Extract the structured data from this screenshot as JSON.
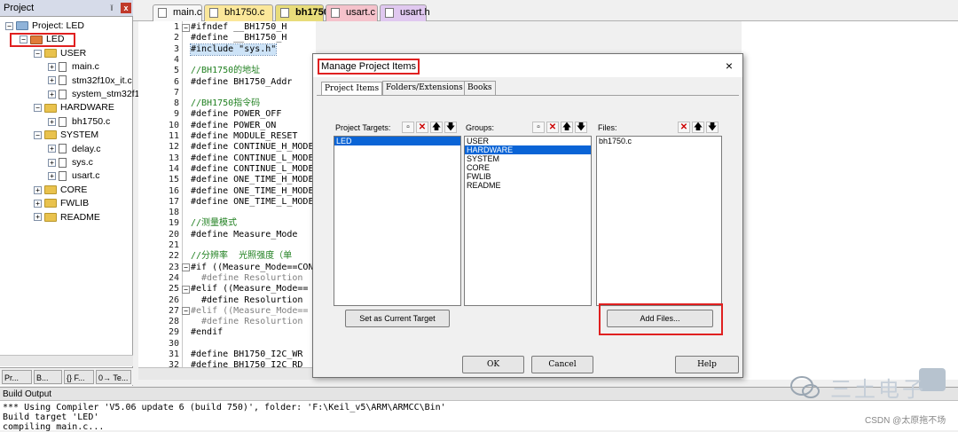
{
  "project_pane": {
    "title": "Project",
    "pin": "ǐ",
    "close": "x",
    "tree": [
      {
        "label": "Project: LED",
        "level": 0,
        "kind": "project",
        "exp": "⊟"
      },
      {
        "label": "LED",
        "level": 1,
        "kind": "target",
        "exp": "⊟"
      },
      {
        "label": "USER",
        "level": 2,
        "kind": "folder",
        "exp": "⊟"
      },
      {
        "label": "main.c",
        "level": 3,
        "kind": "file",
        "exp": "⊞"
      },
      {
        "label": "stm32f10x_it.c",
        "level": 3,
        "kind": "file",
        "exp": "⊞"
      },
      {
        "label": "system_stm32f1",
        "level": 3,
        "kind": "file",
        "exp": "⊞"
      },
      {
        "label": "HARDWARE",
        "level": 2,
        "kind": "folder",
        "exp": "⊟"
      },
      {
        "label": "bh1750.c",
        "level": 3,
        "kind": "file",
        "exp": "⊞"
      },
      {
        "label": "SYSTEM",
        "level": 2,
        "kind": "folder",
        "exp": "⊟"
      },
      {
        "label": "delay.c",
        "level": 3,
        "kind": "file",
        "exp": "⊞"
      },
      {
        "label": "sys.c",
        "level": 3,
        "kind": "file",
        "exp": "⊞"
      },
      {
        "label": "usart.c",
        "level": 3,
        "kind": "file",
        "exp": "⊞"
      },
      {
        "label": "CORE",
        "level": 2,
        "kind": "folder",
        "exp": "⊞"
      },
      {
        "label": "FWLIB",
        "level": 2,
        "kind": "folder",
        "exp": "⊞"
      },
      {
        "label": "README",
        "level": 2,
        "kind": "folder",
        "exp": "⊞"
      }
    ],
    "bottom_tabs": [
      "Pr...",
      "B...",
      "{} F...",
      "0→ Te..."
    ]
  },
  "editor_tabs": [
    {
      "label": "main.c",
      "color": "#f7f7f7"
    },
    {
      "label": "bh1750.c",
      "color": "#fbe79a"
    },
    {
      "label": "bh1750.h",
      "color": "#fbe79a",
      "active": true
    },
    {
      "label": "usart.c",
      "color": "#f5c2cb"
    },
    {
      "label": "usart.h",
      "color": "#e0c8f0"
    }
  ],
  "code_lines": [
    {
      "n": "1",
      "t": "#ifndef __BH1750_H",
      "fold": "⊟"
    },
    {
      "n": "2",
      "t": "#define __BH1750_H"
    },
    {
      "n": "3",
      "t": "#include \"sys.h\"",
      "hl": true
    },
    {
      "n": "4",
      "t": ""
    },
    {
      "n": "5",
      "t": "//BH1750的地址",
      "cmt": true
    },
    {
      "n": "6",
      "t": "#define BH1750_Addr"
    },
    {
      "n": "7",
      "t": ""
    },
    {
      "n": "8",
      "t": "//BH1750指令码",
      "cmt": true
    },
    {
      "n": "9",
      "t": "#define POWER_OFF"
    },
    {
      "n": "10",
      "t": "#define POWER_ON"
    },
    {
      "n": "11",
      "t": "#define MODULE_RESET"
    },
    {
      "n": "12",
      "t": "#define CONTINUE_H_MODE"
    },
    {
      "n": "13",
      "t": "#define CONTINUE_L_MODE"
    },
    {
      "n": "14",
      "t": "#define CONTINUE_L_MODE"
    },
    {
      "n": "15",
      "t": "#define ONE_TIME_H_MODE"
    },
    {
      "n": "16",
      "t": "#define ONE_TIME_H_MODE"
    },
    {
      "n": "17",
      "t": "#define ONE_TIME_L_MODE"
    },
    {
      "n": "18",
      "t": ""
    },
    {
      "n": "19",
      "t": "//测量模式",
      "cmt": true
    },
    {
      "n": "20",
      "t": "#define Measure_Mode"
    },
    {
      "n": "21",
      "t": ""
    },
    {
      "n": "22",
      "t": "//分辨率  光照强度（单",
      "cmt": true
    },
    {
      "n": "23",
      "t": "#if ((Measure_Mode==CON",
      "fold": "⊟"
    },
    {
      "n": "24",
      "t": "  #define Resolurtion",
      "dim": true
    },
    {
      "n": "25",
      "t": "#elif ((Measure_Mode==",
      "fold": "⊟"
    },
    {
      "n": "26",
      "t": "  #define Resolurtion"
    },
    {
      "n": "27",
      "t": "#elif ((Measure_Mode==",
      "fold": "⊟",
      "dim": true
    },
    {
      "n": "28",
      "t": "  #define Resolurtion",
      "dim": true
    },
    {
      "n": "29",
      "t": "#endif"
    },
    {
      "n": "30",
      "t": ""
    },
    {
      "n": "31",
      "t": "#define BH1750_I2C_WR"
    },
    {
      "n": "32",
      "t": "#define BH1750_I2C_RD"
    }
  ],
  "dialog": {
    "title": "Manage Project Items",
    "close": "×",
    "tabs": [
      "Project Items",
      "Folders/Extensions",
      "Books"
    ],
    "targets_label": "Project Targets:",
    "targets": [
      "LED"
    ],
    "groups_label": "Groups:",
    "groups": [
      "USER",
      "HARDWARE",
      "SYSTEM",
      "CORE",
      "FWLIB",
      "README"
    ],
    "files_label": "Files:",
    "files": [
      "bh1750.c"
    ],
    "set_target_btn": "Set as Current Target",
    "add_files_btn": "Add Files...",
    "ok_btn": "OK",
    "cancel_btn": "Cancel",
    "help_btn": "Help"
  },
  "build_output": {
    "title": "Build Output",
    "lines": [
      "*** Using Compiler 'V5.06 update 6 (build 750)', folder: 'F:\\Keil_v5\\ARM\\ARMCC\\Bin'",
      "Build target 'LED'",
      "compiling main.c..."
    ]
  },
  "watermark": {
    "text": "三土电子",
    "csdn": "CSDN @太原拖不场"
  },
  "colors": {
    "highlight": "#0a64d6",
    "red_box": "#e02020",
    "comment": "#208020"
  }
}
